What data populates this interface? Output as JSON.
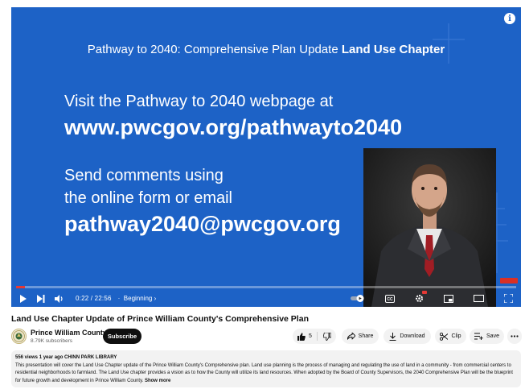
{
  "slide": {
    "title_plain": "Pathway to 2040: Comprehensive Plan Update ",
    "title_bold": "Land Use Chapter",
    "line1": "Visit the Pathway to 2040 webpage at",
    "line2": "www.pwcgov.org/pathwayto2040",
    "line3": "Send comments using",
    "line4": "the online form or email",
    "line5": "pathway2040@pwcgov.org"
  },
  "player": {
    "progress": 0.017,
    "time": "0:22 / 22:56",
    "chapter": "Beginning",
    "colors": {
      "background": "#1d62c6",
      "progress": "#e53935"
    }
  },
  "video": {
    "title": "Land Use Chapter Update of Prince William County's Comprehensive Plan"
  },
  "channel": {
    "name": "Prince William County",
    "subscribers": "8.79K subscribers",
    "subscribe_label": "Subscribe"
  },
  "actions": {
    "likes": "5",
    "share": "Share",
    "download": "Download",
    "clip": "Clip",
    "save": "Save"
  },
  "description": {
    "meta": "556 views  1 year ago  CHINN PARK LIBRARY",
    "text": "This presentation will cover the Land Use Chapter update of the Prince William County's Comprehensive plan. Land use planning is the process of managing and regulating the use of land in a community - from commercial centers to residential neighborhoods to farmland. The Land Use chapter provides a vision as to how the County will utilize its land resources. When adopted by the Board of County Supervisors, the 2040 Comprehensive Plan will be the blueprint for future growth and development in Prince William County.",
    "show_more": "Show more"
  },
  "icons": [
    "info-icon",
    "play-icon",
    "next-icon",
    "volume-icon",
    "chevron-right-icon",
    "autoplay-toggle",
    "captions-icon",
    "settings-icon",
    "miniplayer-icon",
    "theater-icon",
    "fullscreen-icon",
    "thumbs-up-icon",
    "thumbs-down-icon",
    "share-icon",
    "download-icon",
    "scissors-icon",
    "save-icon",
    "more-icon"
  ]
}
